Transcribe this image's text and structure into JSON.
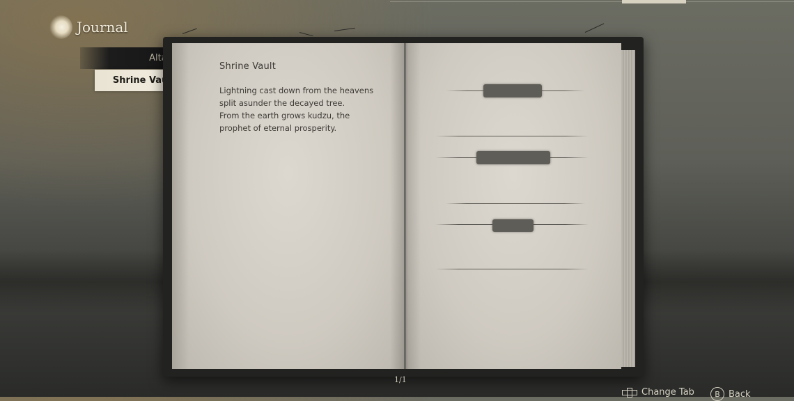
{
  "header": {
    "title": "Journal"
  },
  "sidebar": {
    "tabs": [
      {
        "label": "Altar",
        "selected": false
      },
      {
        "label": "Shrine Vault",
        "selected": true
      }
    ]
  },
  "book": {
    "entry_title": "Shrine Vault",
    "entry_lines": [
      "Lightning cast down from the heavens split asunder the decayed tree.",
      "From the earth grows kudzu, the prophet of eternal prosperity."
    ],
    "page_counter": "1/1"
  },
  "hints": {
    "change_tab": "Change Tab",
    "back_button_glyph": "B",
    "back": "Back"
  },
  "icons": {
    "journal": "journal-icon",
    "dpad": "dpad-icon",
    "b_button": "b-button-icon"
  },
  "colors": {
    "selected_tab_bg": "#f3eee2",
    "unselected_tab_bg": "#1c1c1c",
    "page_paper": "#d6d2c9",
    "redaction": "#5f5d57"
  }
}
